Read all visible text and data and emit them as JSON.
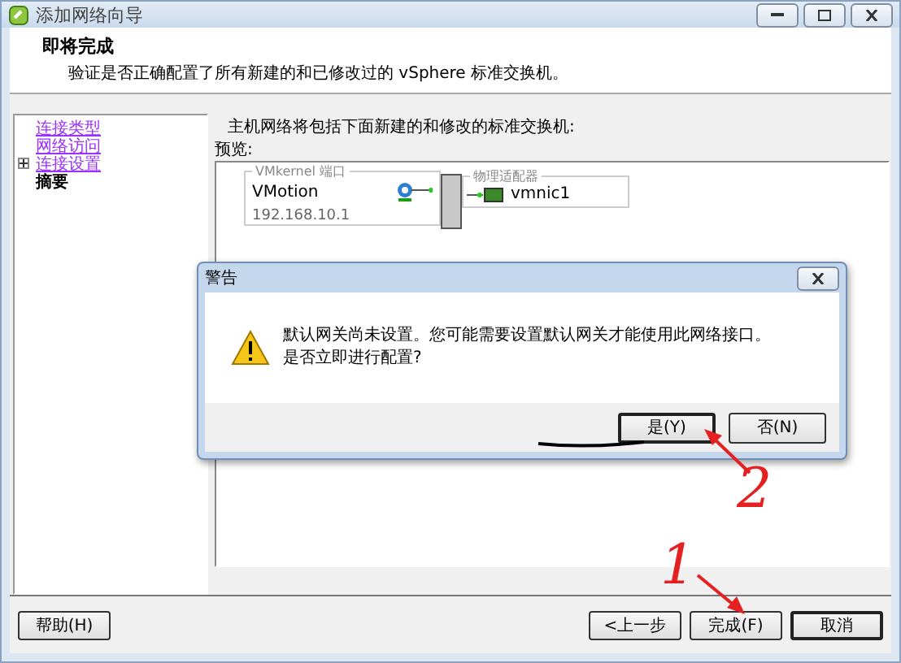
{
  "window": {
    "title": "添加网络向导"
  },
  "header": {
    "title": "即将完成",
    "subtitle": "验证是否正确配置了所有新建的和已修改过的 vSphere 标准交换机。"
  },
  "steps": [
    {
      "label": "连接类型",
      "kind": "link",
      "expander": false
    },
    {
      "label": "网络访问",
      "kind": "link",
      "expander": false
    },
    {
      "label": "连接设置",
      "kind": "link",
      "expander": true
    },
    {
      "label": "摘要",
      "kind": "current",
      "expander": false
    }
  ],
  "summary": {
    "intro": "主机网络将包括下面新建的和修改的标准交换机:",
    "preview_label": "预览:"
  },
  "diagram": {
    "port_group": {
      "caption": "VMkernel 端口",
      "name": "VMotion",
      "ip": "192.168.10.1"
    },
    "adapters": {
      "caption": "物理适配器",
      "items": [
        "vmnic1"
      ]
    }
  },
  "dialog": {
    "title": "警告",
    "message": [
      "默认网关尚未设置。您可能需要设置默认网关才能使用此网络接口。",
      "是否立即进行配置?"
    ],
    "buttons": [
      {
        "label": "是(Y)",
        "focused": true
      },
      {
        "label": "否(N)",
        "focused": false
      }
    ]
  },
  "buttons": {
    "help": "帮助(H)",
    "back": "<上一步",
    "finish": "完成(F)",
    "cancel": "取消"
  },
  "annotations": [
    {
      "text": "1"
    },
    {
      "text": "2"
    }
  ]
}
